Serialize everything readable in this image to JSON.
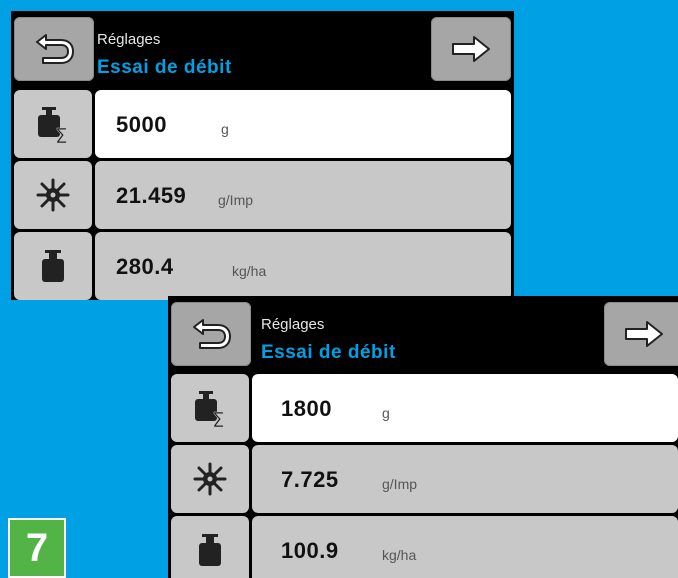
{
  "colors": {
    "background": "#00a0e4",
    "header_title": "#00a0e4",
    "button_gray": "#a6a6a6",
    "cell_gray": "#c8c8c8",
    "badge_green": "#52b447"
  },
  "screens": [
    {
      "header": {
        "small": "Réglages",
        "title": "Essai de débit",
        "back_icon": "back-arrow-icon",
        "next_icon": "forward-arrow-icon"
      },
      "rows": [
        {
          "icon": "weight-sum-icon",
          "value": "5000",
          "unit": "g"
        },
        {
          "icon": "sprocket-icon",
          "value": "21.459",
          "unit": "g/Imp"
        },
        {
          "icon": "weight-icon",
          "value": "280.4",
          "unit": "kg/ha"
        }
      ]
    },
    {
      "header": {
        "small": "Réglages",
        "title": "Essai de débit",
        "back_icon": "back-arrow-icon",
        "next_icon": "forward-arrow-icon"
      },
      "rows": [
        {
          "icon": "weight-sum-icon",
          "value": "1800",
          "unit": "g"
        },
        {
          "icon": "sprocket-icon",
          "value": "7.725",
          "unit": "g/Imp"
        },
        {
          "icon": "weight-icon",
          "value": "100.9",
          "unit": "kg/ha"
        }
      ]
    }
  ],
  "step_badge": "7"
}
